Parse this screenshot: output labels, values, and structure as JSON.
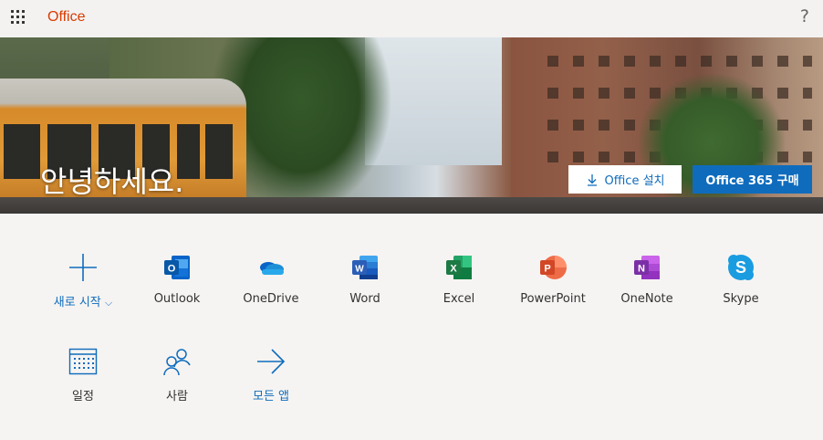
{
  "header": {
    "brand": "Office",
    "waffle_icon": "app-launcher-icon",
    "help_label": "?"
  },
  "hero": {
    "greeting": "안녕하세요.",
    "install_button": "Office 설치",
    "buy_button": "Office 365 구매"
  },
  "apps": [
    {
      "label": "새로 시작",
      "icon": "plus-icon",
      "chevron": "⌵"
    },
    {
      "label": "Outlook",
      "icon": "outlook-icon"
    },
    {
      "label": "OneDrive",
      "icon": "onedrive-icon"
    },
    {
      "label": "Word",
      "icon": "word-icon"
    },
    {
      "label": "Excel",
      "icon": "excel-icon"
    },
    {
      "label": "PowerPoint",
      "icon": "powerpoint-icon"
    },
    {
      "label": "OneNote",
      "icon": "onenote-icon"
    },
    {
      "label": "Skype",
      "icon": "skype-icon"
    },
    {
      "label": "일정",
      "icon": "calendar-icon"
    },
    {
      "label": "사람",
      "icon": "people-icon"
    },
    {
      "label": "모든 앱",
      "icon": "arrow-right-icon"
    }
  ],
  "colors": {
    "office_orange": "#d83b01",
    "primary_blue": "#0f6cbd",
    "outlook": "#0a64c8",
    "onedrive": "#1e8fd6",
    "word": "#2b5eb8",
    "excel": "#1d7a44",
    "powerpoint": "#d24726",
    "onenote": "#7b2fa6",
    "skype": "#1a9ce0"
  }
}
